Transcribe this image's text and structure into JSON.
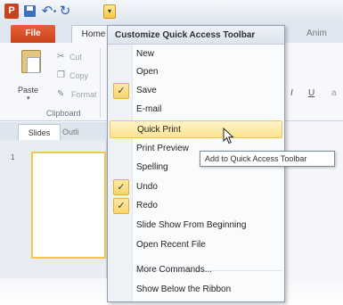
{
  "qat": {
    "app_letter": "P",
    "undo_glyph": "↶",
    "redo_glyph": "↻",
    "menu_glyph": "▾"
  },
  "tabs": {
    "file": "File",
    "home": "Home",
    "animations": "Anim"
  },
  "clipboard": {
    "paste": "Paste",
    "cut": "Cut",
    "copy": "Copy",
    "format_painter": "Format",
    "group_label": "Clipboard"
  },
  "font_buttons": {
    "italic": "I",
    "underline": "U",
    "more": "a"
  },
  "slides_pane": {
    "tab_slides": "Slides",
    "tab_outline": "Outli",
    "slide_number": "1"
  },
  "menu": {
    "title": "Customize Quick Access Toolbar",
    "items": [
      {
        "label": "New",
        "checked": false
      },
      {
        "label": "Open",
        "checked": false
      },
      {
        "label": "Save",
        "checked": true
      },
      {
        "label": "E-mail",
        "checked": false
      },
      {
        "label": "Quick Print",
        "checked": false,
        "hover": true
      },
      {
        "label": "Print Preview",
        "checked": false
      },
      {
        "label": "Spelling",
        "checked": false
      },
      {
        "label": "Undo",
        "checked": true
      },
      {
        "label": "Redo",
        "checked": true
      },
      {
        "label": "Slide Show From Beginning",
        "checked": false
      },
      {
        "label": "Open Recent File",
        "checked": false
      }
    ],
    "more_commands": "More Commands...",
    "show_below": "Show Below the Ribbon",
    "check_glyph": "✓"
  },
  "tooltip": "Add to Quick Access Toolbar",
  "colors": {
    "file_tab": "#c8431c",
    "highlight": "#fde48f",
    "check_bg": "#fbd46a"
  }
}
